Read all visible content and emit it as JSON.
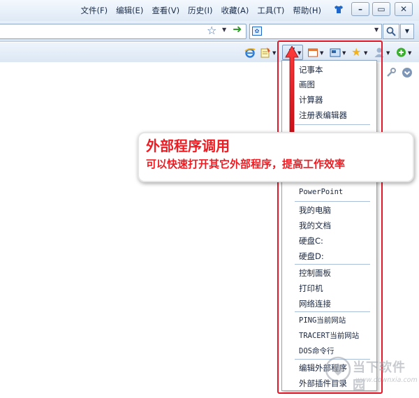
{
  "menubar": {
    "items": [
      "文件(F)",
      "编辑(E)",
      "查看(V)",
      "历史(I)",
      "收藏(A)",
      "工具(T)",
      "帮助(H)"
    ],
    "buttons": [
      "minimize",
      "maximize",
      "close"
    ]
  },
  "addressbar": {
    "url_value": "",
    "search_value": ""
  },
  "toolbar": {
    "icons": [
      "ie-icon",
      "notes-icon",
      "external-program-icon",
      "window-icon",
      "screenshot-icon",
      "favorites-star-icon",
      "user-icon",
      "add-icon"
    ]
  },
  "dropdown": {
    "groups": [
      [
        "记事本",
        "画图",
        "计算器",
        "注册表编辑器"
      ],
      [
        "PowerPoint"
      ],
      [
        "我的电脑",
        "我的文档",
        "硬盘C:",
        "硬盘D:"
      ],
      [
        "控制面板",
        "打印机",
        "网络连接"
      ],
      [
        "PING当前网站",
        "TRACERT当前网站",
        "DOS命令行"
      ],
      [
        "编辑外部程序",
        "外部插件目录"
      ]
    ]
  },
  "callout": {
    "title": "外部程序调用",
    "description": "可以快速打开其它外部程序，提高工作效率"
  },
  "watermark": {
    "name": "当下软件园",
    "url": "www.downxia.com"
  },
  "colors": {
    "annotation_red": "#ee1d23",
    "frame_red": "#e0182a",
    "chrome_blue": "#dce7f4"
  }
}
